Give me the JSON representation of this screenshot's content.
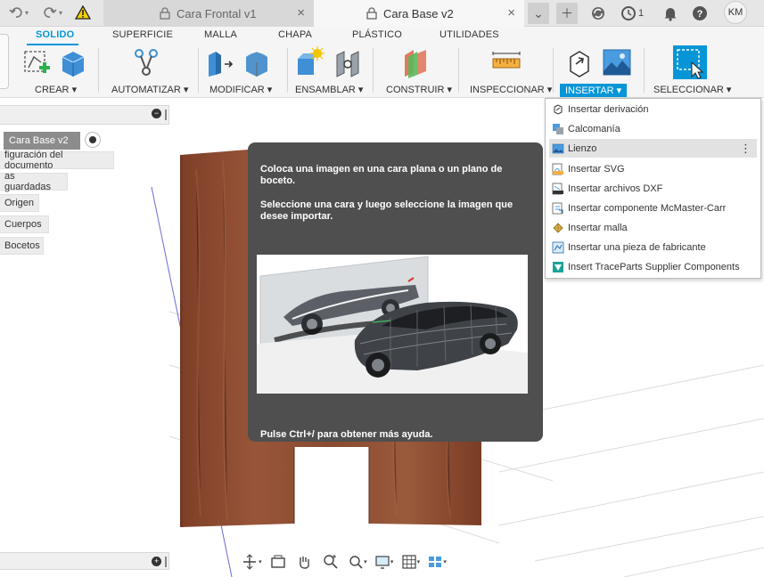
{
  "titlebar": {
    "tabs": [
      {
        "label": "Cara Frontal v1"
      },
      {
        "label": "Cara Base v2"
      }
    ],
    "job_count": "1",
    "user_initials": "KM"
  },
  "ribbon": {
    "tabs": [
      "SOLIDO",
      "SUPERFICIE",
      "MALLA",
      "CHAPA",
      "PLÁSTICO",
      "UTILIDADES"
    ],
    "groups": [
      "CREAR",
      "AUTOMATIZAR",
      "MODIFICAR",
      "ENSAMBLAR",
      "CONSTRUIR",
      "INSPECCIONAR",
      "INSERTAR",
      "SELECCIONAR"
    ]
  },
  "browser": {
    "root": "Cara Base v2",
    "items": [
      "figuración del documento",
      "as guardadas",
      "Origen",
      "Cuerpos",
      "Bocetos"
    ]
  },
  "tooltip": {
    "line1": "Coloca una imagen en una cara plana o un plano de boceto.",
    "line2": "Seleccione una cara y luego seleccione la imagen que desee importar.",
    "help": "Pulse Ctrl+/ para obtener más ayuda."
  },
  "insert_menu": {
    "items": [
      {
        "label": "Insertar derivación",
        "icon": "derive-icon"
      },
      {
        "label": "Calcomanía",
        "icon": "decal-icon"
      },
      {
        "label": "Lienzo",
        "icon": "canvas-icon",
        "highlighted": true
      },
      {
        "label": "Insertar SVG",
        "icon": "svg-icon"
      },
      {
        "label": "Insertar archivos DXF",
        "icon": "dxf-icon"
      },
      {
        "label": "Insertar componente McMaster-Carr",
        "icon": "mcmaster-icon"
      },
      {
        "label": "Insertar malla",
        "icon": "mesh-icon"
      },
      {
        "label": "Insertar una pieza de fabricante",
        "icon": "manufacturer-part-icon"
      },
      {
        "label": "Insert TraceParts Supplier Components",
        "icon": "traceparts-icon"
      }
    ]
  },
  "colors": {
    "accent": "#0696d7",
    "tooltip_bg": "#4f4f4f",
    "body_wood": "#8b4a30"
  }
}
